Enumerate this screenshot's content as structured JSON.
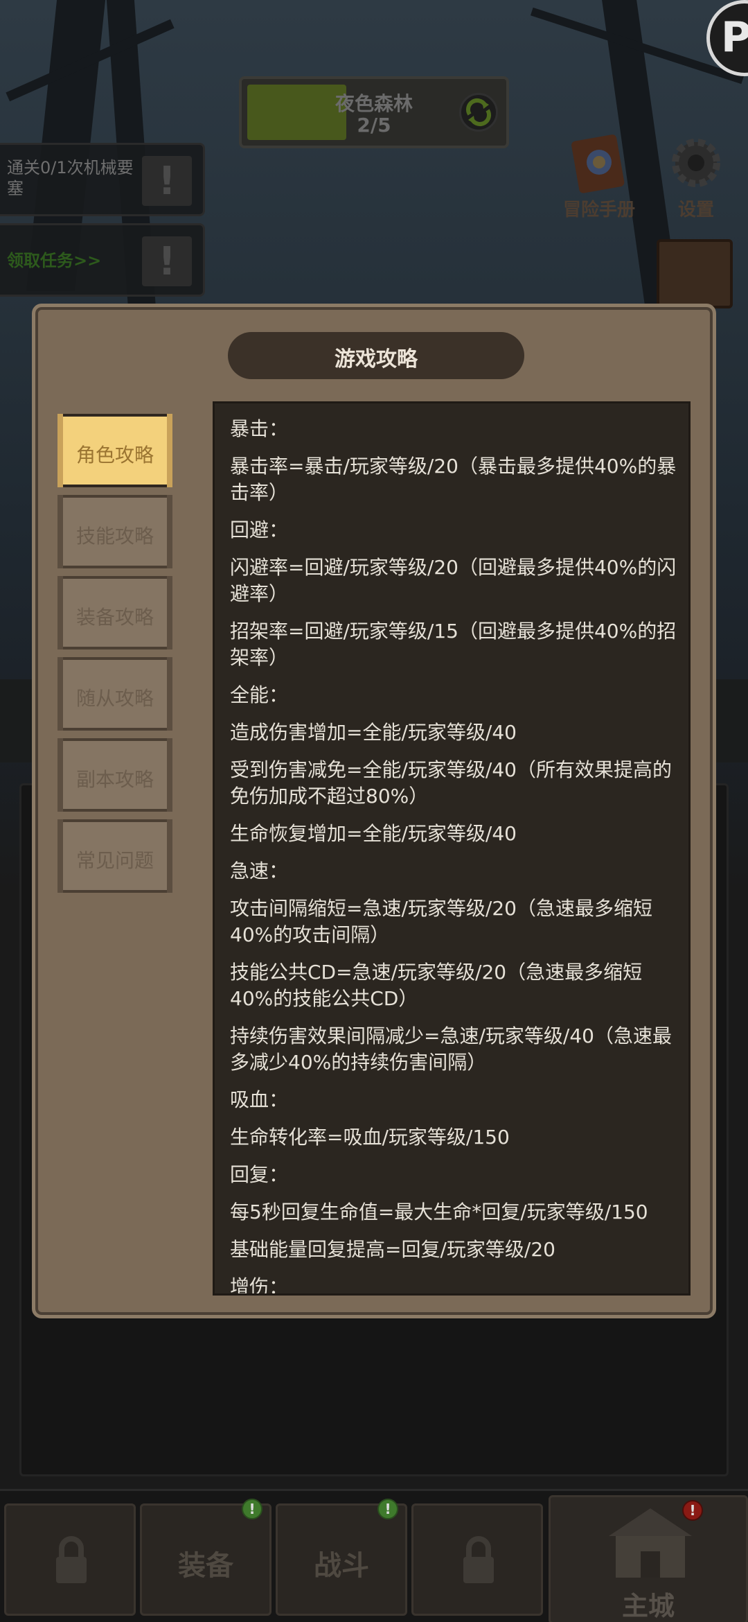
{
  "stage": {
    "name": "夜色森林",
    "count": "2/5",
    "progress": 0.4
  },
  "quests": [
    {
      "text": "通关0/1次机械要塞"
    },
    {
      "text": "领取任务>>"
    }
  ],
  "hud": {
    "manual_label": "冒险手册",
    "settings_label": "设置"
  },
  "corner_badge": "P",
  "modal": {
    "title": "游戏攻略",
    "tabs": [
      {
        "label": "角色攻略",
        "active": true
      },
      {
        "label": "技能攻略",
        "active": false
      },
      {
        "label": "装备攻略",
        "active": false
      },
      {
        "label": "随从攻略",
        "active": false
      },
      {
        "label": "副本攻略",
        "active": false
      },
      {
        "label": "常见问题",
        "active": false
      }
    ],
    "lines": [
      "暴击：",
      "暴击率=暴击/玩家等级/20（暴击最多提供40%的暴击率）",
      "回避：",
      "闪避率=回避/玩家等级/20（回避最多提供40%的闪避率）",
      "招架率=回避/玩家等级/15（回避最多提供40%的招架率）",
      "全能：",
      "造成伤害增加=全能/玩家等级/40",
      "受到伤害减免=全能/玩家等级/40（所有效果提高的免伤加成不超过80%）",
      "生命恢复增加=全能/玩家等级/40",
      "急速：",
      "攻击间隔缩短=急速/玩家等级/20（急速最多缩短40%的攻击间隔）",
      "技能公共CD=急速/玩家等级/20（急速最多缩短40%的技能公共CD）",
      "持续伤害效果间隔减少=急速/玩家等级/40（急速最多减少40%的持续伤害间隔）",
      "吸血：",
      "生命转化率=吸血/玩家等级/150",
      "回复：",
      "每5秒回复生命值=最大生命*回复/玩家等级/150",
      "基础能量回复提高=回复/玩家等级/20",
      "增伤："
    ]
  },
  "nav": {
    "equip_label": "装备",
    "battle_label": "战斗",
    "home_label": "主城"
  }
}
